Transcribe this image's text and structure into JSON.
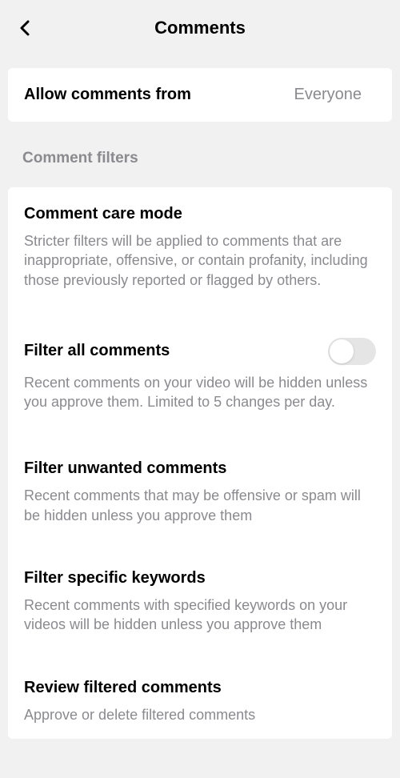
{
  "header": {
    "title": "Comments"
  },
  "allow_row": {
    "label": "Allow comments from",
    "value": "Everyone"
  },
  "section_header": "Comment filters",
  "items": [
    {
      "title": "Comment care mode",
      "desc": "Stricter filters will be applied to comments that are inappropriate, offensive, or contain profanity, including those previously reported or flagged by others.",
      "control": "chevron"
    },
    {
      "title": "Filter all comments",
      "desc": "Recent comments on your video will be hidden unless you approve them. Limited to 5 changes per day.",
      "control": "toggle",
      "toggle_on": false
    },
    {
      "title": "Filter unwanted comments",
      "desc": "Recent comments that may be offensive or spam will be hidden unless you approve them",
      "control": "chevron"
    },
    {
      "title": "Filter specific keywords",
      "desc": "Recent comments with specified keywords on your videos will be hidden unless you approve them",
      "control": "chevron"
    },
    {
      "title": "Review filtered comments",
      "desc": "Approve or delete filtered comments",
      "control": "chevron"
    }
  ]
}
